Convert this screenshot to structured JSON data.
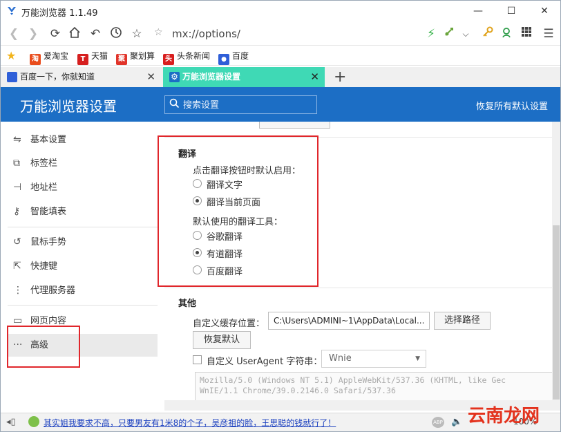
{
  "window": {
    "title": "万能浏览器 1.1.49",
    "minimize": "—",
    "maximize": "☐",
    "close": "✕"
  },
  "nav": {
    "url": "mx://options/"
  },
  "bookmarks": [
    {
      "label": "爱淘宝",
      "icon_char": "淘",
      "color": "#e94d1d"
    },
    {
      "label": "天猫",
      "icon_char": "T",
      "color": "#d61f1f"
    },
    {
      "label": "聚划算",
      "icon_char": "聚",
      "color": "#e1342a"
    },
    {
      "label": "头条新闻",
      "icon_char": "头",
      "color": "#d81e1e"
    },
    {
      "label": "百度",
      "icon_char": "🐾",
      "color": "#2f5fd8"
    }
  ],
  "tabs": [
    {
      "label": "百度一下，你就知道",
      "close": "✕"
    },
    {
      "label": "万能浏览器设置",
      "close": "✕"
    }
  ],
  "new_tab": "+",
  "header": {
    "title": "万能浏览器设置",
    "search_placeholder": "搜索设置",
    "reset_all": "恢复所有默认设置"
  },
  "sidebar": {
    "items": [
      {
        "label": "基本设置",
        "icon": "sliders-icon"
      },
      {
        "label": "标签栏",
        "icon": "tab-icon"
      },
      {
        "label": "地址栏",
        "icon": "addressbar-icon"
      },
      {
        "label": "智能填表",
        "icon": "key-icon"
      },
      {
        "label": "鼠标手势",
        "icon": "gesture-icon"
      },
      {
        "label": "快捷键",
        "icon": "shortcut-icon"
      },
      {
        "label": "代理服务器",
        "icon": "proxy-icon"
      },
      {
        "label": "网页内容",
        "icon": "page-icon"
      },
      {
        "label": "高级",
        "icon": "more-icon"
      }
    ],
    "active": "高级"
  },
  "translate": {
    "title": "翻译",
    "click_label": "点击翻译按钮时默认启用：",
    "click_options": [
      "翻译文字",
      "翻译当前页面"
    ],
    "click_selected": 1,
    "tool_label": "默认使用的翻译工具：",
    "tool_options": [
      "谷歌翻译",
      "有道翻译",
      "百度翻译"
    ],
    "tool_selected": 1
  },
  "other": {
    "title": "其他",
    "cache_label": "自定义缓存位置：",
    "cache_path": "C:\\Users\\ADMINI~1\\AppData\\Local...",
    "choose_path": "选择路径",
    "restore_default": "恢复默认",
    "ua_label": "自定义 UserAgent 字符串：",
    "ua_select": "Wnie",
    "ua_text": "Mozilla/5.0 (Windows NT 5.1) AppleWebKit/537.36 (KHTML, like Gec\nWnIE/1.1 Chrome/39.0.2146.0 Safari/537.36"
  },
  "statusbar": {
    "news": "其实姐我要求不高，只要男友有1米8的个子，吴彦祖的脸，王思聪的钱就行了！",
    "zoom": "100%"
  },
  "watermark": "云南龙网",
  "colors": {
    "header_blue": "#1c6ec5",
    "active_tab": "#3fd9b5",
    "highlight_red": "#e0262b"
  }
}
